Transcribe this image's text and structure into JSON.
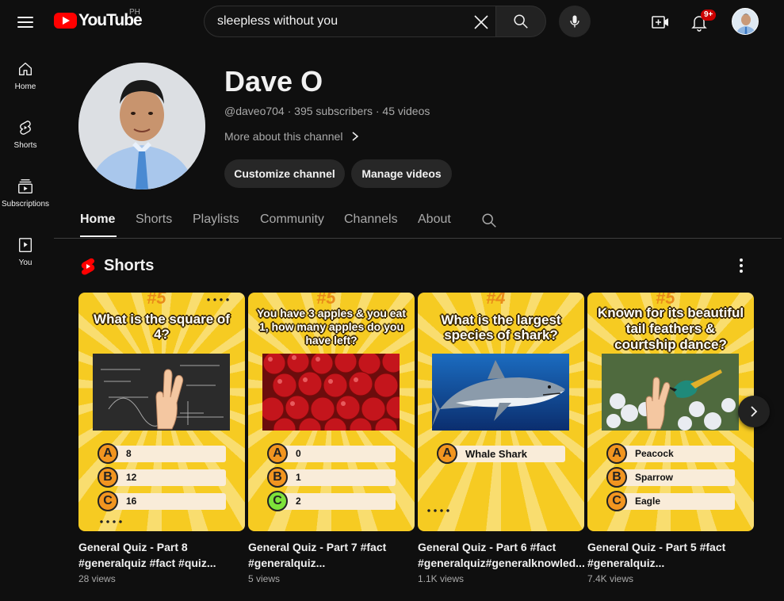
{
  "header": {
    "logo_text": "YouTube",
    "country_code": "PH",
    "search": {
      "value": "sleepless without you",
      "placeholder": "Search"
    },
    "notification_count": "9+"
  },
  "sidenav": {
    "items": [
      {
        "label": "Home",
        "icon": "home-icon"
      },
      {
        "label": "Shorts",
        "icon": "shorts-icon"
      },
      {
        "label": "Subscriptions",
        "icon": "subscriptions-icon"
      },
      {
        "label": "You",
        "icon": "you-icon"
      }
    ]
  },
  "channel": {
    "name": "Dave O",
    "meta": "@daveo704 · 395 subscribers · 45 videos",
    "about_link": "More about this channel",
    "buttons": {
      "customize": "Customize channel",
      "manage": "Manage videos"
    }
  },
  "tabs": [
    "Home",
    "Shorts",
    "Playlists",
    "Community",
    "Channels",
    "About"
  ],
  "active_tab": "Home",
  "shorts_section": {
    "title": "Shorts",
    "items": [
      {
        "number": "#5",
        "question": "What is the square of 4?",
        "options": [
          {
            "letter": "A",
            "text": "8"
          },
          {
            "letter": "B",
            "text": "12"
          },
          {
            "letter": "C",
            "text": "16"
          }
        ],
        "title_line1": "General Quiz - Part 8",
        "title_line2": "#generalquiz #fact #quiz...",
        "views": "28 views"
      },
      {
        "number": "#5",
        "question": "You have 3 apples & you eat 1, how many apples do you have left?",
        "options": [
          {
            "letter": "A",
            "text": "0"
          },
          {
            "letter": "B",
            "text": "1"
          },
          {
            "letter": "C",
            "text": "2"
          }
        ],
        "title_line1": "General Quiz - Part 7 #fact",
        "title_line2": "#generalquiz...",
        "views": "5 views"
      },
      {
        "number": "#4",
        "question": "What is the largest species of shark?",
        "options": [
          {
            "letter": "A",
            "text": "Whale Shark"
          }
        ],
        "title_line1": "General Quiz - Part 6 #fact",
        "title_line2": "#generalquiz#generalknowled...",
        "views": "1.1K views"
      },
      {
        "number": "#5",
        "question": "Known for its beautiful tail feathers & courtship dance?",
        "options": [
          {
            "letter": "A",
            "text": "Peacock"
          },
          {
            "letter": "B",
            "text": "Sparrow"
          },
          {
            "letter": "C",
            "text": "Eagle"
          }
        ],
        "title_line1": "General Quiz - Part 5 #fact",
        "title_line2": "#generalquiz...",
        "views": "7.4K views"
      }
    ]
  },
  "colors": {
    "background": "#0f0f0f",
    "brand_red": "#ff0000",
    "thumb_yellow": "#f6cb22",
    "option_orange": "#f29520",
    "option_correct": "#7ee23a"
  }
}
